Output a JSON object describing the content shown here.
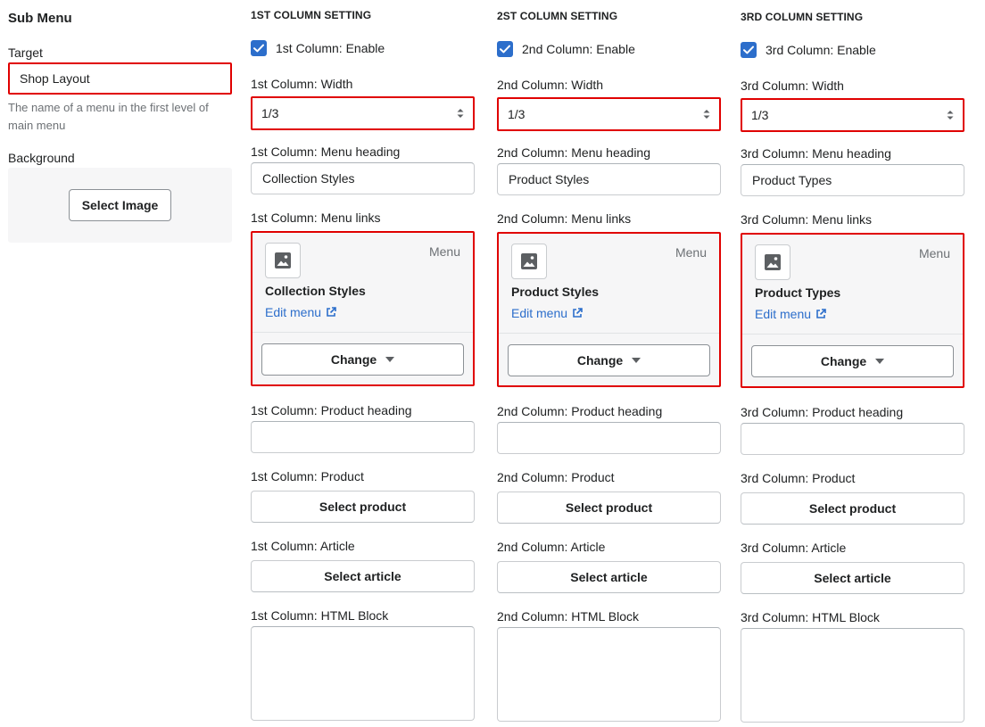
{
  "sidebar": {
    "title": "Sub Menu",
    "target_label": "Target",
    "target_value": "Shop Layout",
    "target_help": "The name of a menu in the first level of main menu",
    "background_label": "Background",
    "select_image_label": "Select Image"
  },
  "columns": [
    {
      "heading": "1ST COLUMN SETTING",
      "enable_label": "1st Column: Enable",
      "enabled": true,
      "width_label": "1st Column: Width",
      "width_value": "1/3",
      "menu_heading_label": "1st Column: Menu heading",
      "menu_heading_value": "Collection Styles",
      "menu_links_label": "1st Column: Menu links",
      "menu_tag": "Menu",
      "menu_name": "Collection Styles",
      "edit_menu": "Edit menu",
      "change_label": "Change",
      "product_heading_label": "1st Column: Product heading",
      "product_heading_value": "",
      "product_label": "1st Column: Product",
      "select_product": "Select product",
      "article_label": "1st Column: Article",
      "select_article": "Select article",
      "html_block_label": "1st Column: HTML Block",
      "html_block_value": ""
    },
    {
      "heading": "2ST COLUMN SETTING",
      "enable_label": "2nd Column: Enable",
      "enabled": true,
      "width_label": "2nd Column: Width",
      "width_value": "1/3",
      "menu_heading_label": "2nd Column: Menu heading",
      "menu_heading_value": "Product Styles",
      "menu_links_label": "2nd Column: Menu links",
      "menu_tag": "Menu",
      "menu_name": "Product Styles",
      "edit_menu": "Edit menu",
      "change_label": "Change",
      "product_heading_label": "2nd Column: Product heading",
      "product_heading_value": "",
      "product_label": "2nd Column: Product",
      "select_product": "Select product",
      "article_label": "2nd Column: Article",
      "select_article": "Select article",
      "html_block_label": "2nd Column: HTML Block",
      "html_block_value": ""
    },
    {
      "heading": "3RD COLUMN SETTING",
      "enable_label": "3rd Column: Enable",
      "enabled": true,
      "width_label": "3rd Column: Width",
      "width_value": "1/3",
      "menu_heading_label": "3rd Column: Menu heading",
      "menu_heading_value": "Product Types",
      "menu_links_label": "3rd Column: Menu links",
      "menu_tag": "Menu",
      "menu_name": "Product Types",
      "edit_menu": "Edit menu",
      "change_label": "Change",
      "product_heading_label": "3rd Column: Product heading",
      "product_heading_value": "",
      "product_label": "3rd Column: Product",
      "select_product": "Select product",
      "article_label": "3rd Column: Article",
      "select_article": "Select article",
      "html_block_label": "3rd Column: HTML Block",
      "html_block_value": ""
    }
  ],
  "colors": {
    "accent": "#2c6ecb",
    "highlight_border": "#e00000",
    "card_background": "#f6f6f7"
  },
  "icons": {
    "checkbox": "checkmark-icon",
    "select": "select-arrows-icon",
    "menu_thumbnail": "image-icon",
    "edit_menu": "external-link-icon",
    "change": "caret-down-icon"
  }
}
